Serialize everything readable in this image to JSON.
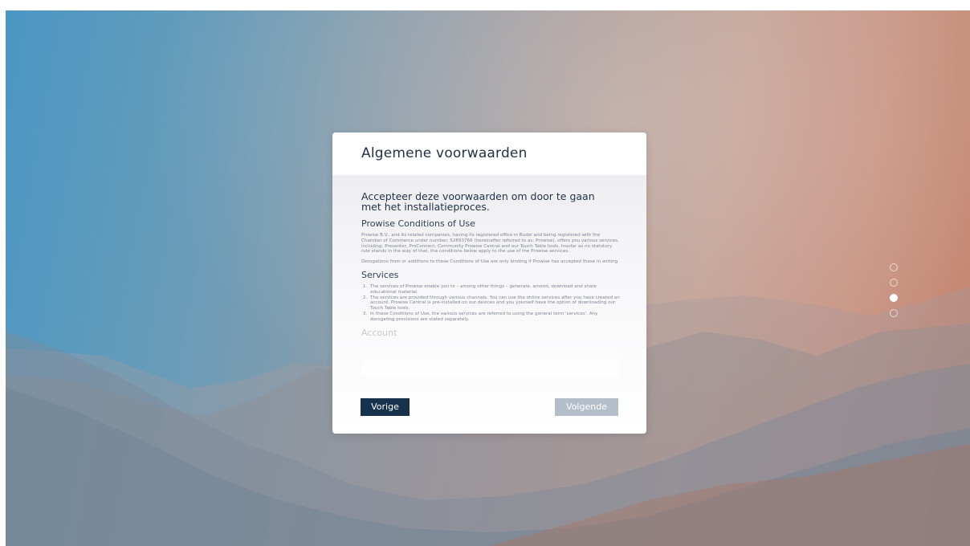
{
  "dialog": {
    "title": "Algemene voorwaarden",
    "lead": "Accepteer deze voorwaarden om door te gaan met het installatieproces.",
    "section1_heading": "Prowise Conditions of Use",
    "section1_para1": "Prowise B.V., and its related companies, having its registered office in Budel and being registered with the Chamber of Commerce under number: 52893766 (hereinafter referred to as: Prowise), offers you various services, including: Presenter, ProConnect, Community Prowise Central and our Touch Table tools. Insofar as no statutory rule stands in the way of that, the conditions below apply to the use of the Prowise services.",
    "section1_para2": "Derogations from or additions to these Conditions of Use are only binding if Prowise has accepted these in writing.",
    "section2_heading": "Services",
    "services": [
      "The services of Prowise enable you to – among other things – generate, amend, download and share educational material.",
      "The services are provided through various channels. You can use the online services after you have created an account. Prowise Central is pre-installed on our devices and you yourself have the option of downloading our Touch Table tools.",
      "In these Conditions of Use, the various services are referred to using the general term 'services'. Any derogating provisions are stated separately."
    ],
    "section3_heading": "Account",
    "prev_label": "Vorige",
    "next_label": "Volgende"
  },
  "pager": {
    "total": 4,
    "active_index": 2
  }
}
